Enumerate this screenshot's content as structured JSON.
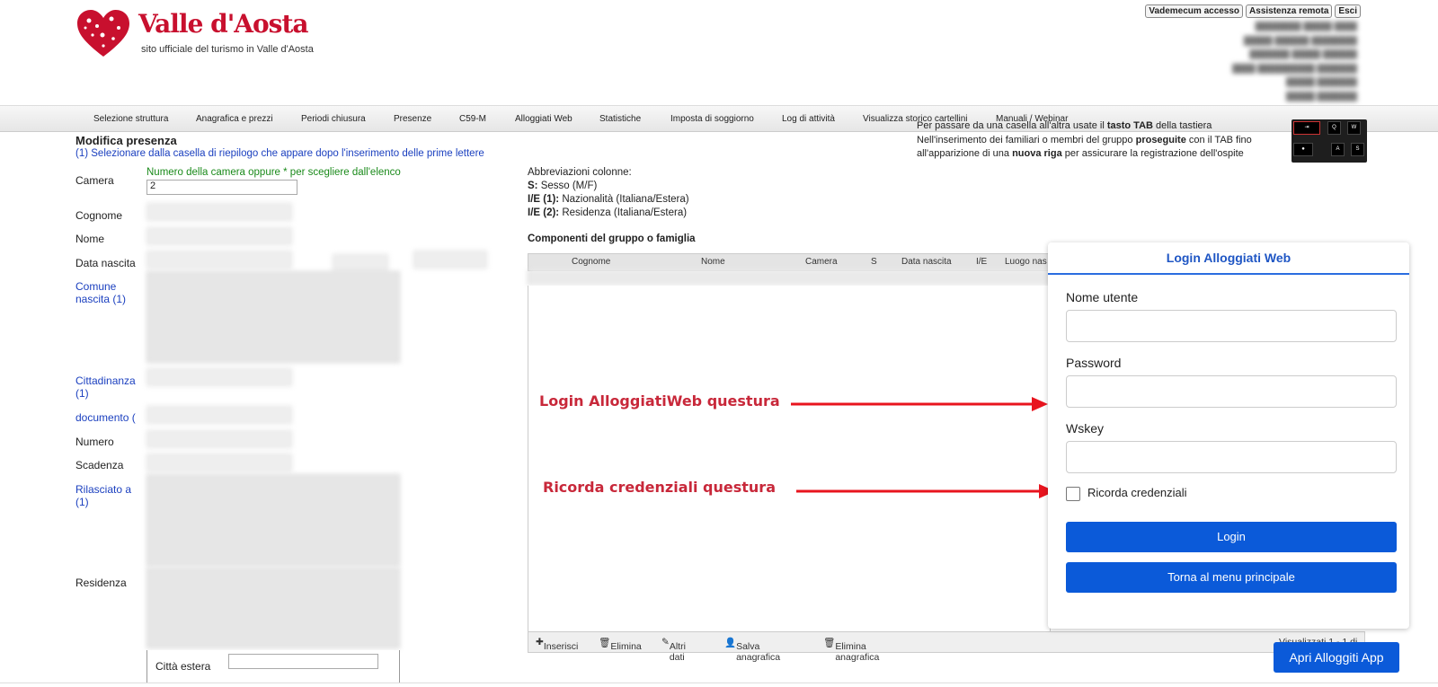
{
  "header": {
    "brand": "Valle d'Aosta",
    "subtitle": "sito ufficiale del turismo in Valle d'Aosta",
    "top_links": [
      "Vademecum accesso",
      "Assistenza remota",
      "Esci"
    ]
  },
  "nav": {
    "items": [
      "Selezione struttura",
      "Anagrafica e prezzi",
      "Periodi chiusura",
      "Presenze",
      "C59-M",
      "Alloggiati Web",
      "Statistiche",
      "Imposta di soggiorno",
      "Log di attività",
      "Visualizza storico cartellini",
      "Manuali / Webinar"
    ]
  },
  "info": {
    "line1_pre": "Per passare da una casella all'altra usate il ",
    "line1_bold": "tasto TAB",
    "line1_post": " della tastiera",
    "line2_pre": "Nell'inserimento dei familiari o membri del gruppo ",
    "line2_bold": "proseguite",
    "line2_post": " con il TAB fino",
    "line3_pre": "all'apparizione di una ",
    "line3_bold": "nuova riga",
    "line3_post": " per assicurare la registrazione dell'ospite",
    "keys": [
      "Q",
      "W",
      "A",
      "S"
    ]
  },
  "form": {
    "title": "Modifica presenza",
    "note": "(1) Selezionare dalla casella di riepilogo che appare dopo l'inserimento delle prime lettere",
    "camera_label": "Camera",
    "camera_hint": "Numero della camera oppure * per scegliere dall'elenco",
    "camera_value": "2",
    "labels": {
      "cognome": "Cognome",
      "nome": "Nome",
      "data_nascita": "Data nascita",
      "comune_nascita": "Comune nascita (1)",
      "cittadinanza": "Cittadinanza (1)",
      "documento": "documento (",
      "numero": "Numero",
      "scadenza": "Scadenza",
      "rilasciato": "Rilasciato a (1)",
      "residenza": "Residenza"
    },
    "citta_estera_label": "Città estera"
  },
  "abbreviations": {
    "heading": "Abbreviazioni colonne:",
    "s_key": "S:",
    "s_text": " Sesso (M/F)",
    "ie1_key": "I/E (1):",
    "ie1_text": " Nazionalità (Italiana/Estera)",
    "ie2_key": "I/E (2):",
    "ie2_text": " Residenza (Italiana/Estera)"
  },
  "group": {
    "title": "Componenti del gruppo o famiglia",
    "columns": [
      "Cognome",
      "Nome",
      "Camera",
      "S",
      "Data nascita",
      "I/E",
      "Luogo nas"
    ],
    "footer_actions": [
      "Inserisci",
      "Elimina",
      "Altri dati",
      "Salva anagrafica",
      "Elimina anagrafica"
    ],
    "footer_count": "Visualizzati 1 - 1 di 1"
  },
  "annotations": {
    "login": "Login AlloggiatiWeb questura",
    "remember": "Ricorda credenziali questura"
  },
  "login_panel": {
    "title": "Login Alloggiati Web",
    "username_label": "Nome utente",
    "password_label": "Password",
    "wskey_label": "Wskey",
    "remember_label": "Ricorda credenziali",
    "login_button": "Login",
    "back_button": "Torna al menu principale"
  },
  "app_button": "Apri Alloggiti App",
  "colors": {
    "accent": "#0b5ad9",
    "annotation": "#c8283a",
    "brand": "#c8102e",
    "note": "#1a3fbf",
    "hint": "#1a8a1a"
  }
}
